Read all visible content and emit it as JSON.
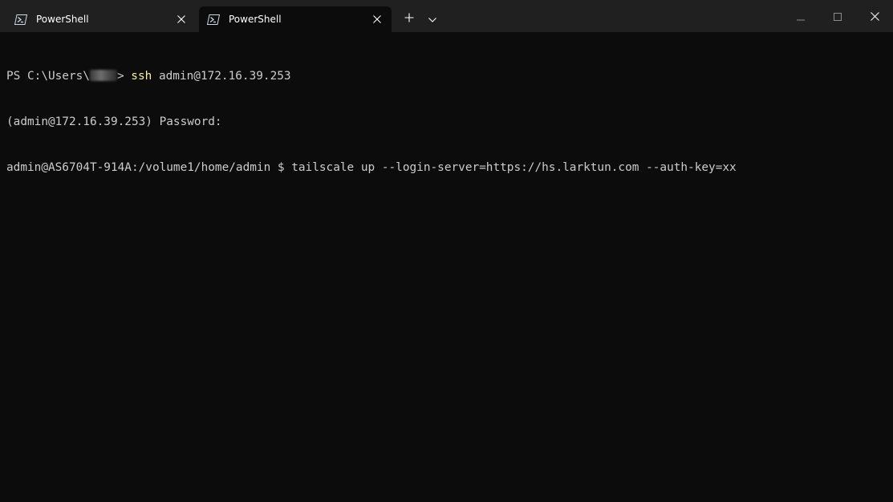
{
  "tabs": [
    {
      "label": "PowerShell",
      "icon": "powershell-icon",
      "active": false
    },
    {
      "label": "PowerShell",
      "icon": "powershell-icon",
      "active": true
    }
  ],
  "colors": {
    "titlebar": "#202020",
    "terminal_bg": "#0c0c0c",
    "text": "#cccccc",
    "command": "#f9f1a5"
  },
  "terminal": {
    "line1": {
      "prompt_prefix": "PS C:\\Users\\",
      "prompt_suffix": "> ",
      "command": "ssh",
      "args": " admin@172.16.39.253"
    },
    "line2": "(admin@172.16.39.253) Password:",
    "line3": "admin@AS6704T-914A:/volume1/home/admin $ tailscale up --login-server=https://hs.larktun.com --auth-key=xx"
  }
}
